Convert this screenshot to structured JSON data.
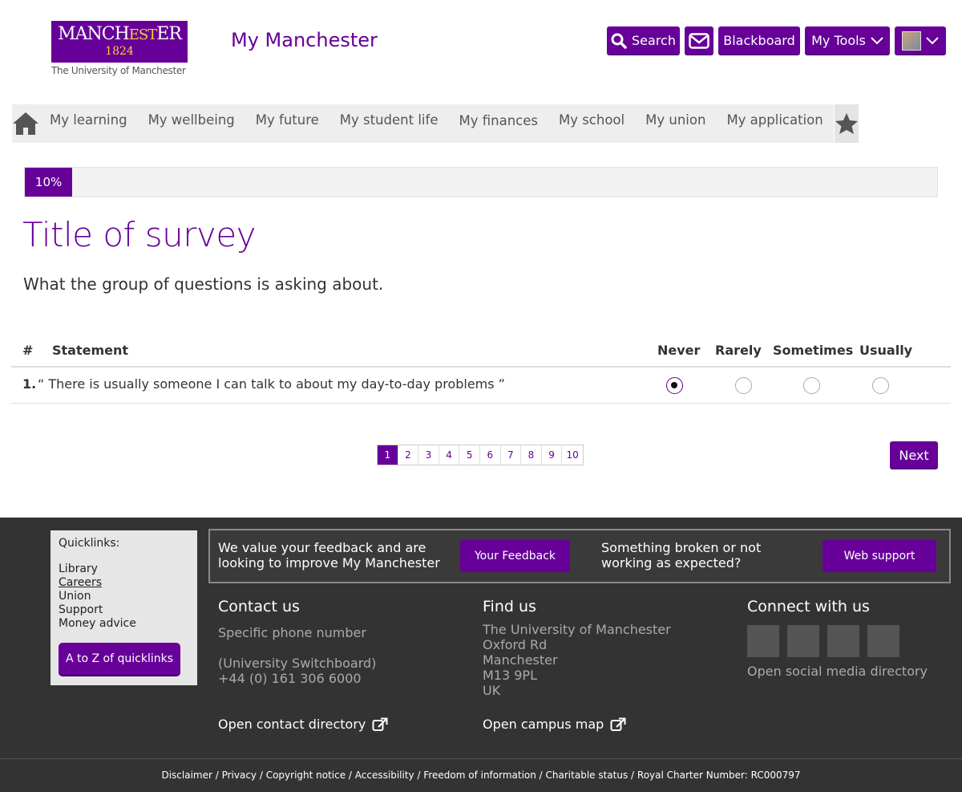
{
  "header": {
    "logo_line1_a": "MANCH",
    "logo_line1_b": "EST",
    "logo_line1_c": "ER",
    "logo_year": "1824",
    "logo_sub": "The University of Manchester",
    "site_title": "My Manchester",
    "search_label": "Search",
    "blackboard_label": "Blackboard",
    "tools_label": "My Tools"
  },
  "nav": {
    "items": [
      "My learning",
      "My wellbeing",
      "My future",
      "My student life",
      "My finances",
      "My school",
      "My union",
      "My application"
    ]
  },
  "progress": {
    "value": 0.1,
    "label": "10%"
  },
  "survey": {
    "title": "Title of survey",
    "subtitle": "What the group of questions is asking about."
  },
  "table": {
    "headers": {
      "num": "#",
      "statement": "Statement",
      "options": [
        "Never",
        "Rarely",
        "Sometimes",
        "Usually"
      ]
    },
    "rows": [
      {
        "num": "1.",
        "statement": "“ There is usually someone I can talk to about my day-to-day problems ”",
        "selected": "Never"
      }
    ]
  },
  "pager": {
    "pages": [
      "1",
      "2",
      "3",
      "4",
      "5",
      "6",
      "7",
      "8",
      "9",
      "10"
    ],
    "current": "1",
    "next_label": "Next"
  },
  "footer": {
    "quicklinks_title": "Quicklinks:",
    "quicklinks": [
      "Library",
      "Careers",
      "Union",
      "Support",
      "Money advice"
    ],
    "az_label": "A to Z of quicklinks",
    "feedback_text": "We value your feedback and are looking to improve My Manchester",
    "feedback_button": "Your Feedback",
    "broken_text": "Something broken or not working as expected?",
    "support_button": "Web support",
    "contact": {
      "title": "Contact us",
      "line1": "Specific phone number",
      "line2": "(University Switchboard)",
      "line3": "+44 (0) 161 306 6000",
      "link": "Open contact directory"
    },
    "find": {
      "title": "Find us",
      "lines": [
        "The University of Manchester",
        "Oxford Rd",
        "Manchester",
        "M13 9PL",
        "UK"
      ],
      "link": "Open campus map"
    },
    "connect": {
      "title": "Connect with us",
      "link": "Open social media directory"
    },
    "legal": "Disclaimer / Privacy / Copyright notice / Accessibility / Freedom of information / Charitable status / Royal Charter Number: RC000797"
  },
  "colors": {
    "brand": "#660099",
    "accent": "#ffcc33",
    "footer_bg": "#333333"
  }
}
